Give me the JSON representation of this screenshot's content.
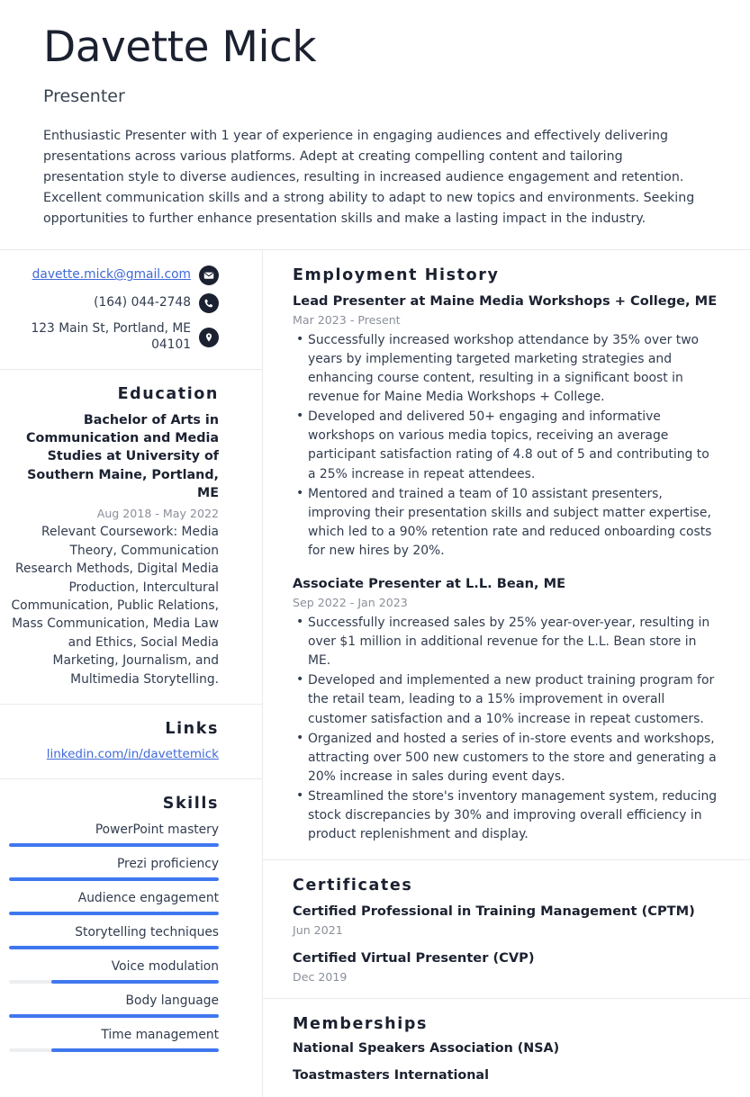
{
  "header": {
    "name": "Davette Mick",
    "job_title": "Presenter",
    "summary": "Enthusiastic Presenter with 1 year of experience in engaging audiences and effectively delivering presentations across various platforms. Adept at creating compelling content and tailoring presentation style to diverse audiences, resulting in increased audience engagement and retention. Excellent communication skills and a strong ability to adapt to new topics and environments. Seeking opportunities to further enhance presentation skills and make a lasting impact in the industry."
  },
  "colors": {
    "accent": "#3f77ef",
    "link": "#3f6ad8",
    "heading": "#1b2130",
    "muted": "#8a8f99",
    "bar_track": "#eceef0",
    "divider": "#e9eaec"
  },
  "contact": {
    "email": {
      "text": "davette.mick@gmail.com",
      "icon": "envelope-icon"
    },
    "phone": {
      "text": "(164) 044-2748",
      "icon": "phone-icon"
    },
    "address": {
      "text": "123 Main St, Portland, ME 04101",
      "icon": "location-pin-icon"
    }
  },
  "education": {
    "heading": "Education",
    "items": [
      {
        "degree": "Bachelor of Arts in Communication and Media Studies at University of Southern Maine, Portland, ME",
        "date": "Aug 2018 - May 2022",
        "description": "Relevant Coursework: Media Theory, Communication Research Methods, Digital Media Production, Intercultural Communication, Public Relations, Mass Communication, Media Law and Ethics, Social Media Marketing, Journalism, and Multimedia Storytelling."
      }
    ]
  },
  "links": {
    "heading": "Links",
    "items": [
      {
        "label": "linkedin.com/in/davettemick"
      }
    ]
  },
  "skills": {
    "heading": "Skills",
    "items": [
      {
        "name": "PowerPoint mastery",
        "level": 100
      },
      {
        "name": "Prezi proficiency",
        "level": 100
      },
      {
        "name": "Audience engagement",
        "level": 100
      },
      {
        "name": "Storytelling techniques",
        "level": 100
      },
      {
        "name": "Voice modulation",
        "level": 80
      },
      {
        "name": "Body language",
        "level": 100
      },
      {
        "name": "Time management",
        "level": 80
      }
    ]
  },
  "employment": {
    "heading": "Employment History",
    "items": [
      {
        "title": "Lead Presenter at Maine Media Workshops + College, ME",
        "date": "Mar 2023 - Present",
        "bullets": [
          "Successfully increased workshop attendance by 35% over two years by implementing targeted marketing strategies and enhancing course content, resulting in a significant boost in revenue for Maine Media Workshops + College.",
          "Developed and delivered 50+ engaging and informative workshops on various media topics, receiving an average participant satisfaction rating of 4.8 out of 5 and contributing to a 25% increase in repeat attendees.",
          "Mentored and trained a team of 10 assistant presenters, improving their presentation skills and subject matter expertise, which led to a 90% retention rate and reduced onboarding costs for new hires by 20%."
        ]
      },
      {
        "title": "Associate Presenter at L.L. Bean, ME",
        "date": "Sep 2022 - Jan 2023",
        "bullets": [
          "Successfully increased sales by 25% year-over-year, resulting in over $1 million in additional revenue for the L.L. Bean store in ME.",
          "Developed and implemented a new product training program for the retail team, leading to a 15% improvement in overall customer satisfaction and a 10% increase in repeat customers.",
          "Organized and hosted a series of in-store events and workshops, attracting over 500 new customers to the store and generating a 20% increase in sales during event days.",
          "Streamlined the store's inventory management system, reducing stock discrepancies by 30% and improving overall efficiency in product replenishment and display."
        ]
      }
    ]
  },
  "certificates": {
    "heading": "Certificates",
    "items": [
      {
        "title": "Certified Professional in Training Management (CPTM)",
        "date": "Jun 2021"
      },
      {
        "title": "Certified Virtual Presenter (CVP)",
        "date": "Dec 2019"
      }
    ]
  },
  "memberships": {
    "heading": "Memberships",
    "items": [
      {
        "title": "National Speakers Association (NSA)"
      },
      {
        "title": "Toastmasters International"
      }
    ]
  }
}
